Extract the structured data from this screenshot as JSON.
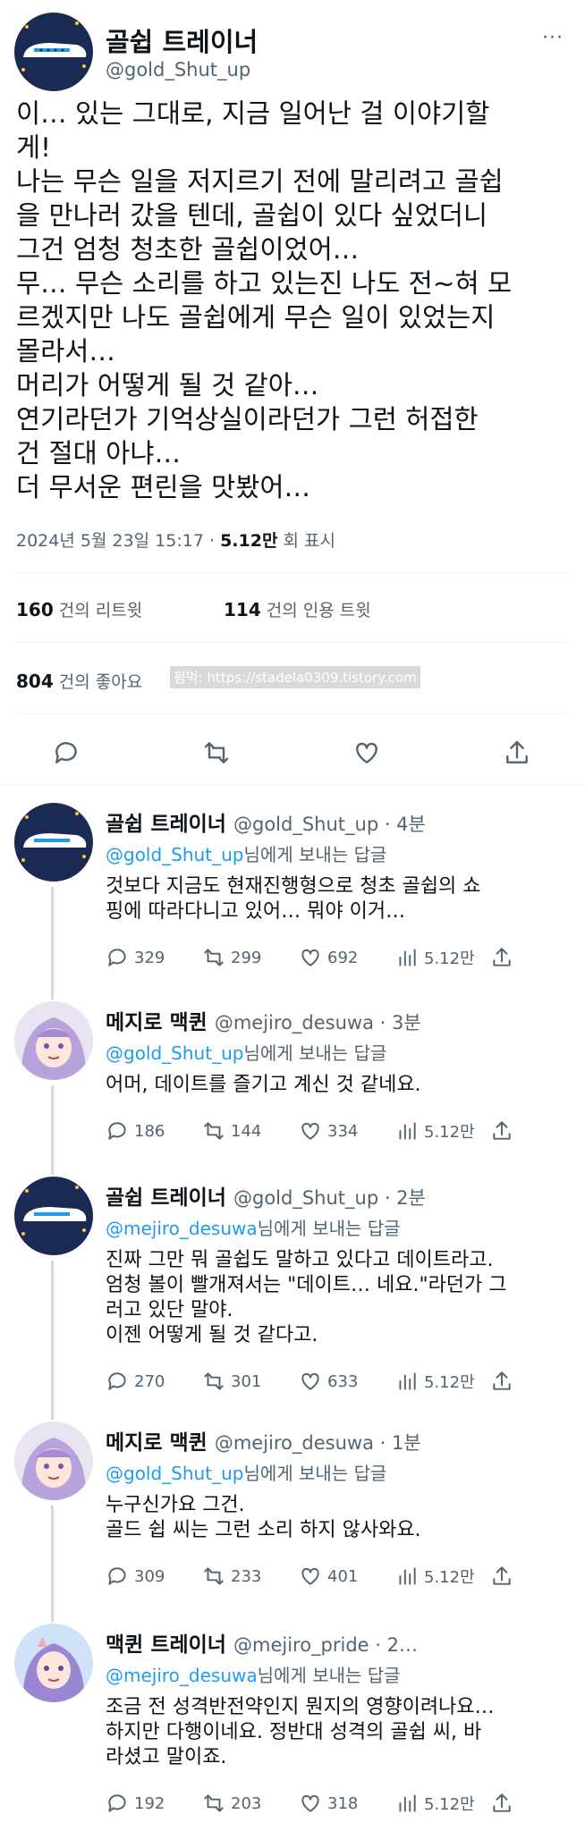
{
  "tweet": {
    "name": "골쉽 트레이너",
    "handle": "@gold_Shut_up",
    "more": "···",
    "body": "이… 있는 그대로, 지금 일어난 걸 이야기할\n게!\n나는 무슨 일을 저지르기 전에 말리려고 골쉽\n을 만나러 갔을 텐데, 골쉽이 있다 싶었더니\n그건 엄청 청초한 골쉽이었어…\n무… 무슨 소리를 하고 있는진 나도 전~혀 모\n르겠지만 나도 골쉽에게 무슨 일이 있었는지\n몰라서…\n머리가 어떻게 될 것 같아…\n연기라던가 기억상실이라던가 그런 허접한\n건 절대 아냐…\n더 무서운 편린을 맛봤어…",
    "date": "2024년 5월 23일  15:17",
    "sep": " · ",
    "views": "5.12만",
    "views_label": " 회 표시",
    "retweets": "160",
    "retweets_label": " 건의 리트윗",
    "quotes": "114",
    "quotes_label": " 건의 인용 트윗",
    "likes": "804",
    "likes_label": " 건의 좋아요",
    "watermark": "펌먹: https://stadela0309.tistory.com"
  },
  "replies": [
    {
      "name": "골쉽 트레이너",
      "handle": "@gold_Shut_up",
      "time": " · 4분",
      "to_handle": "@gold_Shut_up",
      "to_label": "님에게 보내는 답글",
      "text": "것보다 지금도 현재진행형으로 청초 골쉽의 쇼\n핑에 따라다니고 있어… 뭐야 이거…",
      "counts": {
        "reply": "329",
        "retweet": "299",
        "like": "692",
        "views": "5.12만"
      }
    },
    {
      "name": "메지로 맥퀸",
      "handle": "@mejiro_desuwa",
      "time": " · 3분",
      "to_handle": "@gold_Shut_up",
      "to_label": "님에게 보내는 답글",
      "text": "어머, 데이트를 즐기고 계신 것 같네요.",
      "counts": {
        "reply": "186",
        "retweet": "144",
        "like": "334",
        "views": "5.12만"
      }
    },
    {
      "name": "골쉽 트레이너",
      "handle": "@gold_Shut_up",
      "time": " · 2분",
      "to_handle": "@mejiro_desuwa",
      "to_label": "님에게 보내는 답글",
      "text": "진짜 그만 뭐 골쉽도 말하고 있다고 데이트라고.\n엄청 볼이 빨개져서는 \"데이트… 네요.\"라던가 그\n러고 있단 말야.\n이젠 어떻게 될 것 같다고.",
      "counts": {
        "reply": "270",
        "retweet": "301",
        "like": "633",
        "views": "5.12만"
      }
    },
    {
      "name": "메지로 맥퀸",
      "handle": "@mejiro_desuwa",
      "time": " · 1분",
      "to_handle": "@gold_Shut_up",
      "to_label": "님에게 보내는 답글",
      "text": "누구신가요 그건.\n골드 쉽 씨는 그런 소리 하지 않사와요.",
      "counts": {
        "reply": "309",
        "retweet": "233",
        "like": "401",
        "views": "5.12만"
      }
    },
    {
      "name": "맥퀸 트레이너",
      "handle": "@mejiro_pride",
      "time": " · 2…",
      "to_handle": "@mejiro_desuwa",
      "to_label": "님에게 보내는 답글",
      "text": "조금 전 성격반전약인지 뭔지의 영향이려나요…\n하지만 다행이네요. 정반대 성격의 골쉽 씨, 바\n라셨고 말이죠.",
      "counts": {
        "reply": "192",
        "retweet": "203",
        "like": "318",
        "views": "5.12만"
      }
    }
  ],
  "colors": {
    "accent": "#1d9bf0",
    "muted": "#536471",
    "text": "#0f1419",
    "avatar_bg": "#1b2a52"
  },
  "icons": [
    "reply-icon",
    "retweet-icon",
    "like-icon",
    "share-icon",
    "views-icon",
    "more-icon",
    "train-avatar",
    "anime-avatar"
  ]
}
